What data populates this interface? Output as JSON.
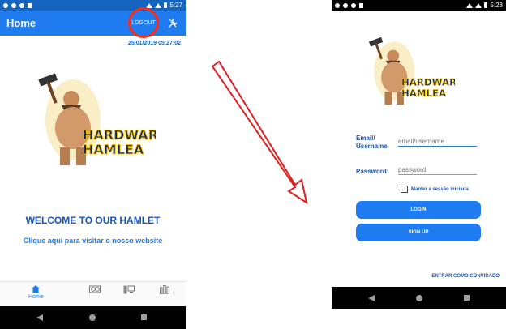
{
  "left_screen": {
    "status": {
      "time": "5:27"
    },
    "appbar": {
      "title": "Home",
      "logout_label": "LOGOUT"
    },
    "timestamp": "25/01/2019 05:27:02",
    "logo": {
      "line1": "HARDWARE",
      "line2": "HAMLEA"
    },
    "welcome": "WELCOME TO OUR HAMLET",
    "visit_link": "Clique aqui para visitar o nosso website",
    "bottom_nav": {
      "home_label": "Home",
      "icons": [
        "home-icon",
        "gpu-icon",
        "pc-icon",
        "stats-icon"
      ]
    }
  },
  "right_screen": {
    "status": {
      "time": "5:28"
    },
    "logo": {
      "line1": "HARDWARE",
      "line2": "HAMLEA"
    },
    "email_label_1": "Email/",
    "email_label_2": "Username",
    "email_placeholder": "email/username",
    "password_label": "Password:",
    "password_placeholder": "password",
    "keep_session": "Manter a sessão iniciada",
    "login_label": "LOGIN",
    "signup_label": "SIGN UP",
    "guest_label": "ENTRAR COMO CONVIDADO"
  },
  "colors": {
    "primary": "#1e7bf0",
    "dark_primary": "#1565c0",
    "highlight": "#ff2a10",
    "heading": "#1a56b5"
  }
}
